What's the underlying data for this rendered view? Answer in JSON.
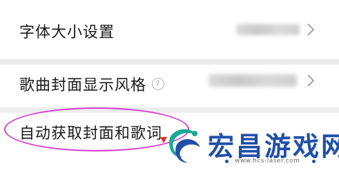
{
  "settings": {
    "items": [
      {
        "label": "字体大小设置",
        "has_help": false
      },
      {
        "label": "歌曲封面显示风格",
        "has_help": true,
        "help_icon": "?"
      },
      {
        "label": "自动获取封面和歌词",
        "has_help": false
      }
    ]
  },
  "watermark": {
    "title": "宏昌游戏网",
    "url": "www.hcs-laser.com"
  },
  "colors": {
    "highlight_ellipse": "#d43bd0",
    "watermark_blue": "#1f4fa8",
    "watermark_green": "#1aa89a"
  }
}
